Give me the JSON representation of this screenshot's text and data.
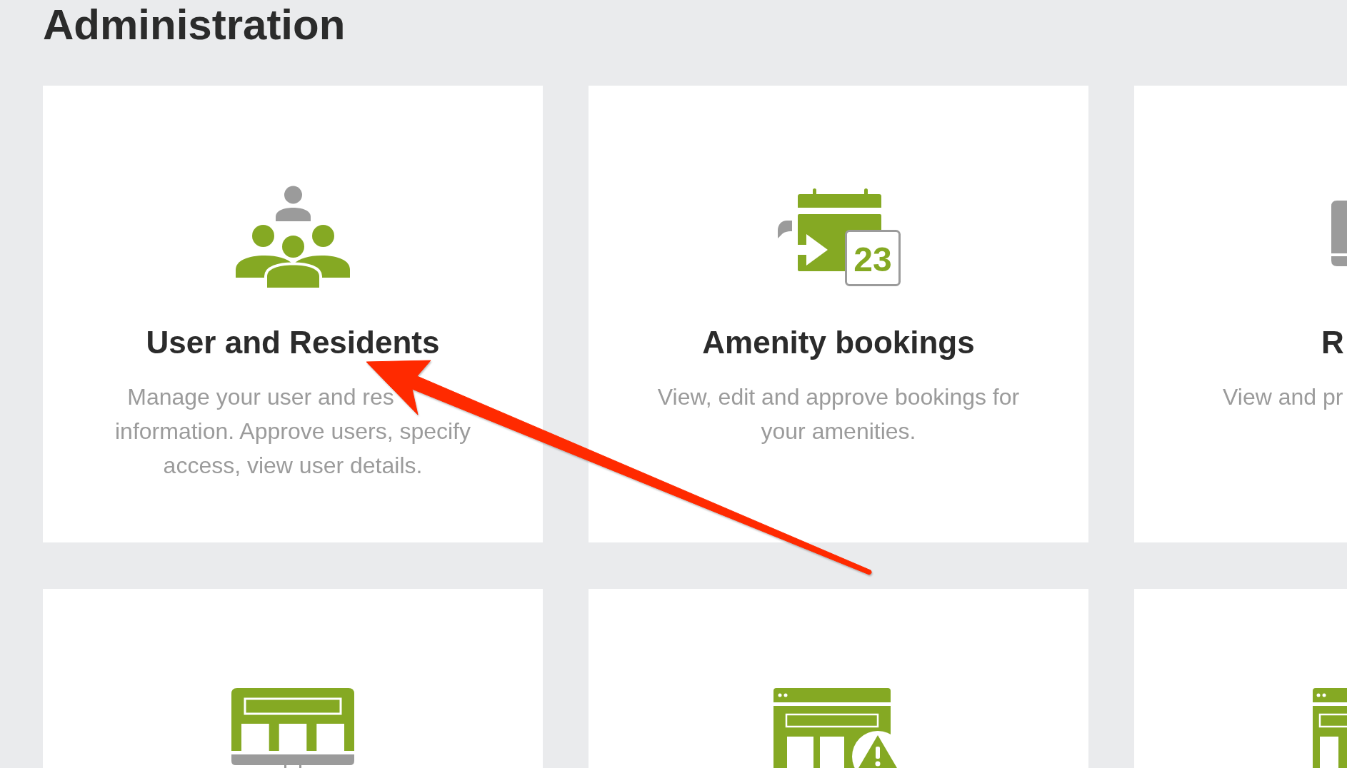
{
  "page": {
    "title": "Administration"
  },
  "cards": [
    {
      "kind": "users",
      "title": "User and Residents",
      "description": "Manage your user and res\ninformation. Approve users, specify\naccess, view user details."
    },
    {
      "kind": "calendar",
      "icon_text": "23",
      "title": "Amenity bookings",
      "description": "View, edit and approve bookings for\nyour amenities."
    },
    {
      "kind": "device",
      "title": "R",
      "description": "View and pr"
    },
    {
      "kind": "store"
    },
    {
      "kind": "alert"
    },
    {
      "kind": "browser"
    }
  ]
}
